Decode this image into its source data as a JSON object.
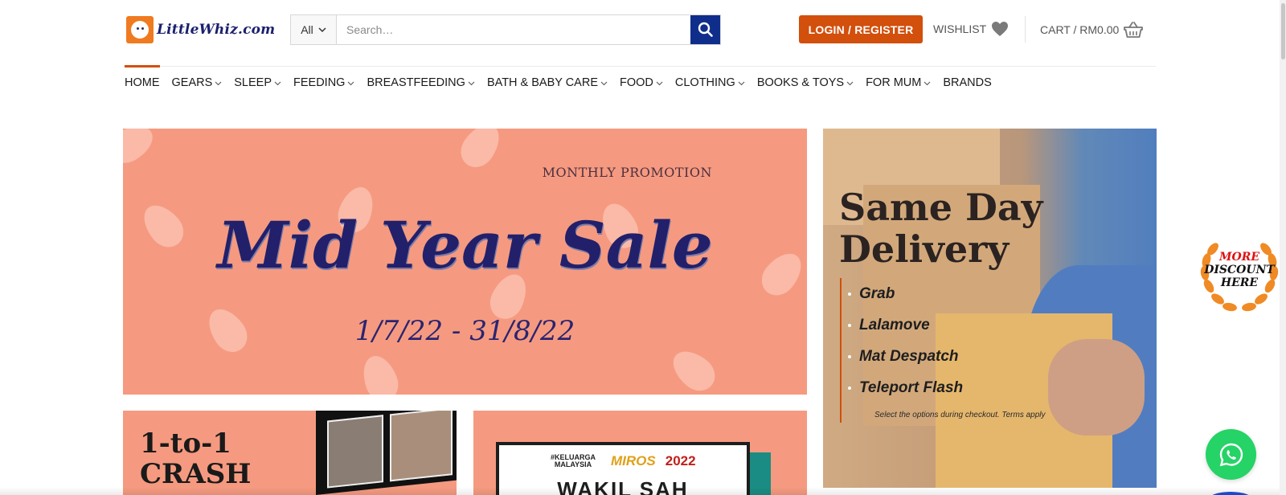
{
  "header": {
    "logo_text": "LittleWhiz.com",
    "search": {
      "category": "All",
      "placeholder": "Search…",
      "value": ""
    },
    "login_label": "LOGIN / REGISTER",
    "wishlist_label": "WISHLIST",
    "cart_label": "CART / RM0.00"
  },
  "nav": {
    "items": [
      {
        "label": "HOME",
        "dropdown": false,
        "active": true
      },
      {
        "label": "GEARS",
        "dropdown": true
      },
      {
        "label": "SLEEP",
        "dropdown": true
      },
      {
        "label": "FEEDING",
        "dropdown": true
      },
      {
        "label": "BREASTFEEDING",
        "dropdown": true
      },
      {
        "label": "BATH & BABY CARE",
        "dropdown": true
      },
      {
        "label": "FOOD",
        "dropdown": true
      },
      {
        "label": "CLOTHING",
        "dropdown": true
      },
      {
        "label": "BOOKS & TOYS",
        "dropdown": true
      },
      {
        "label": "FOR MUM",
        "dropdown": true
      },
      {
        "label": "BRANDS",
        "dropdown": false
      }
    ]
  },
  "banner": {
    "label": "MONTHLY PROMOTION",
    "title": "Mid Year Sale",
    "dates": "1/7/22 - 31/8/22"
  },
  "side": {
    "title_line1": "Same Day",
    "title_line2": "Delivery",
    "options": [
      "Grab",
      "Lalamove",
      "Mat Despatch",
      "Teleport Flash"
    ],
    "note": "Select the options during checkout. Terms apply"
  },
  "card_left": {
    "line1": "1-to-1",
    "line2": "CRASH"
  },
  "card_right": {
    "tag1": "#KELUARGA MALAYSIA",
    "tag2": "MIROS",
    "tag3": "2022",
    "title": "WAKIL SAH"
  },
  "floating": {
    "discount_line1": "MORE",
    "discount_line2": "DISCOUNT",
    "discount_line3": "HERE"
  },
  "colors": {
    "brand_orange": "#d24f0c",
    "search_blue": "#0f2e8c",
    "banner_salmon": "#f59a80",
    "sale_navy": "#22206a",
    "whatsapp_green": "#25d366"
  },
  "icons": [
    "search-icon",
    "chevron-down-icon",
    "heart-icon",
    "basket-icon",
    "whatsapp-icon",
    "laurel-icon"
  ]
}
